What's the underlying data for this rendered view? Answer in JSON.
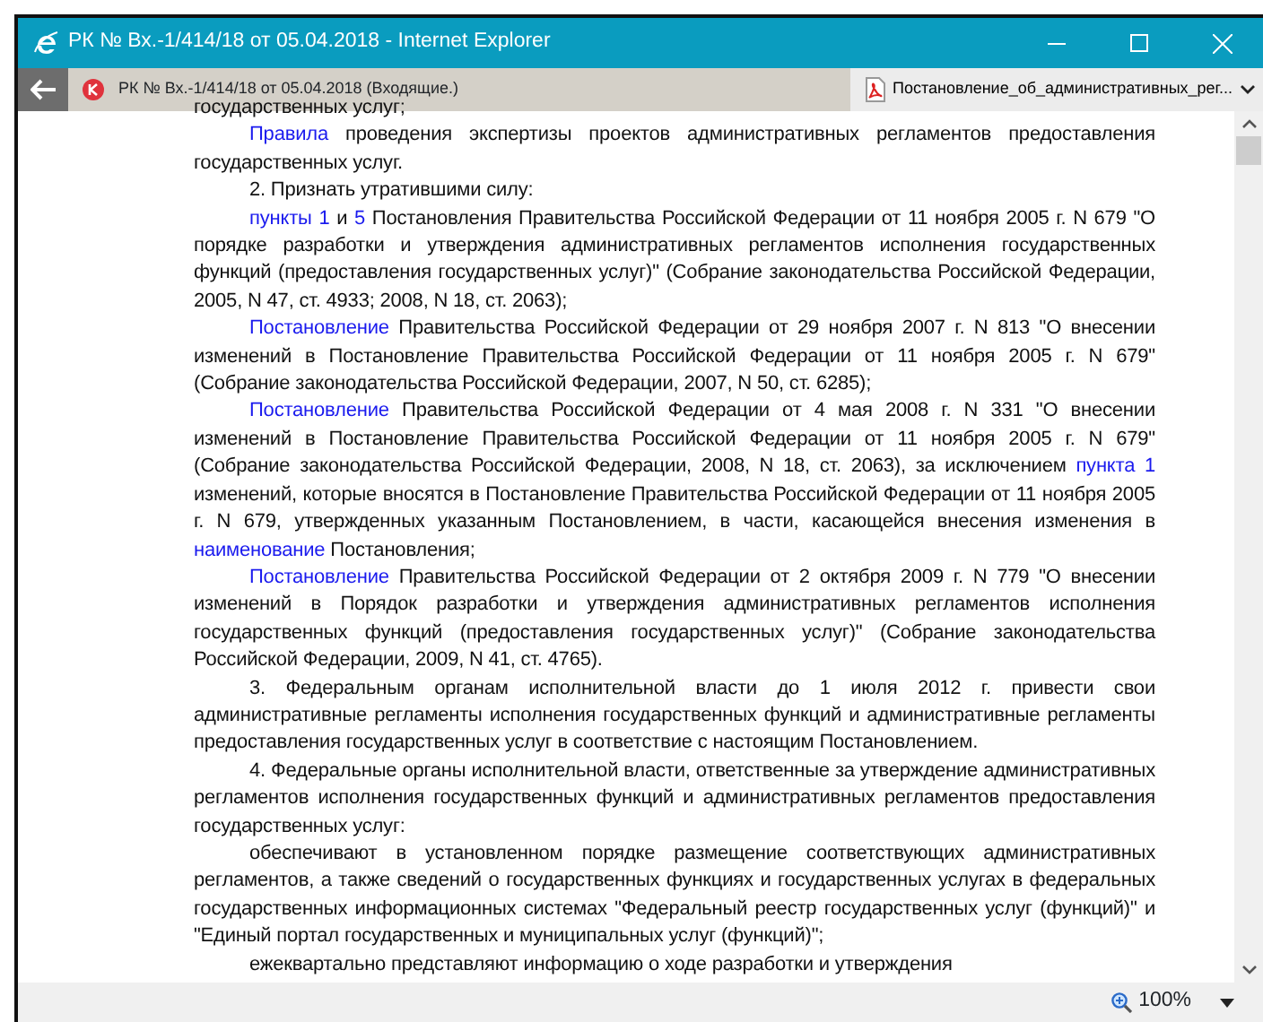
{
  "window": {
    "title": "РК № Вх.-1/414/18 от 05.04.2018 - Internet Explorer"
  },
  "tab": {
    "title": "РК № Вх.-1/414/18 от 05.04.2018 (Входящие.)"
  },
  "attachment": {
    "name": "Постановление_об_административных_рег..."
  },
  "document": {
    "paragraphs": [
      {
        "indent": false,
        "segments": [
          {
            "text": "государственных услуг;",
            "link": false
          }
        ]
      },
      {
        "indent": true,
        "segments": [
          {
            "text": "Правила",
            "link": true
          },
          {
            "text": " проведения экспертизы проектов административных регламентов предоставления государственных услуг.",
            "link": false
          }
        ]
      },
      {
        "indent": true,
        "segments": [
          {
            "text": "2. Признать утратившими силу:",
            "link": false
          }
        ]
      },
      {
        "indent": true,
        "segments": [
          {
            "text": "пункты 1",
            "link": true
          },
          {
            "text": " и ",
            "link": false
          },
          {
            "text": "5",
            "link": true
          },
          {
            "text": " Постановления Правительства Российской Федерации от 11 ноября 2005 г. N 679 \"О порядке разработки и утверждения административных регламентов исполнения государственных функций (предоставления государственных услуг)\" (Собрание законодательства Российской Федерации, 2005, N 47, ст. 4933; 2008, N 18, ст. 2063);",
            "link": false
          }
        ]
      },
      {
        "indent": true,
        "segments": [
          {
            "text": "Постановление",
            "link": true
          },
          {
            "text": " Правительства Российской Федерации от 29 ноября 2007 г. N 813 \"О внесении изменений в Постановление Правительства Российской Федерации от 11 ноября 2005 г. N 679\" (Собрание законодательства Российской Федерации, 2007, N 50, ст. 6285);",
            "link": false
          }
        ]
      },
      {
        "indent": true,
        "segments": [
          {
            "text": "Постановление",
            "link": true
          },
          {
            "text": " Правительства Российской Федерации от 4 мая 2008 г. N 331 \"О внесении изменений в Постановление Правительства Российской Федерации от 11 ноября 2005 г. N 679\" (Собрание законодательства Российской Федерации, 2008, N 18, ст. 2063), за исключением ",
            "link": false
          },
          {
            "text": "пункта 1",
            "link": true
          },
          {
            "text": " изменений, которые вносятся в Постановление Правительства Российской Федерации от 11 ноября 2005 г. N 679, утвержденных указанным Постановлением, в части, касающейся внесения изменения в ",
            "link": false
          },
          {
            "text": "наименование",
            "link": true
          },
          {
            "text": " Постановления;",
            "link": false
          }
        ]
      },
      {
        "indent": true,
        "segments": [
          {
            "text": "Постановление",
            "link": true
          },
          {
            "text": " Правительства Российской Федерации от 2 октября 2009 г. N 779 \"О внесении изменений в Порядок разработки и утверждения административных регламентов исполнения государственных функций (предоставления государственных услуг)\" (Собрание законодательства Российской Федерации, 2009, N 41, ст. 4765).",
            "link": false
          }
        ]
      },
      {
        "indent": true,
        "segments": [
          {
            "text": "3. Федеральным органам исполнительной власти до 1 июля 2012 г. привести свои административные регламенты исполнения государственных функций и административные регламенты предоставления государственных услуг в соответствие с настоящим Постановлением.",
            "link": false
          }
        ]
      },
      {
        "indent": true,
        "segments": [
          {
            "text": "4. Федеральные органы исполнительной власти, ответственные за утверждение административных регламентов исполнения государственных функций и административных регламентов предоставления государственных услуг:",
            "link": false
          }
        ]
      },
      {
        "indent": true,
        "segments": [
          {
            "text": "обеспечивают в установленном порядке размещение соответствующих административных регламентов, а также сведений о государственных функциях и государственных услугах в федеральных государственных информационных системах \"Федеральный реестр государственных услуг (функций)\" и \"Единый портал государственных и муниципальных услуг (функций)\";",
            "link": false
          }
        ]
      },
      {
        "indent": true,
        "segments": [
          {
            "text": "ежеквартально представляют информацию о ходе разработки и утверждения",
            "link": false
          }
        ]
      }
    ]
  },
  "status_bar": {
    "zoom": "100%"
  }
}
